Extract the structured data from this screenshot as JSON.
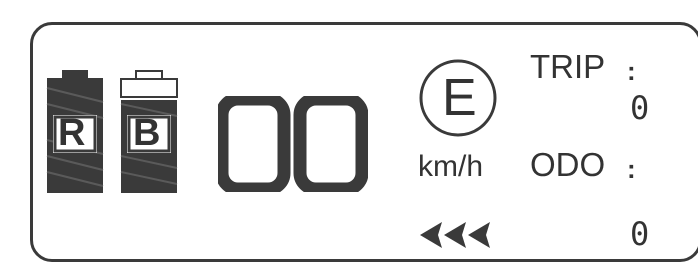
{
  "display": {
    "battery_left_letter": "R",
    "battery_right_letter": "B",
    "speed_digits": "00",
    "gear_letter": "E",
    "speed_unit": "km/h",
    "trip": {
      "label": "TRIP",
      "separator": ":",
      "value": "0"
    },
    "odo": {
      "label": "ODO",
      "separator": ":",
      "value": "0"
    },
    "icons": {
      "battery_left": "battery-r-icon",
      "battery_right": "battery-b-icon",
      "arrows": "triple-left-arrows-icon",
      "gear_circle": "gear-e-circle-icon"
    },
    "colors": {
      "segment": "#3a3a3a",
      "border": "#3a3a3a",
      "background": "#ffffff"
    }
  }
}
